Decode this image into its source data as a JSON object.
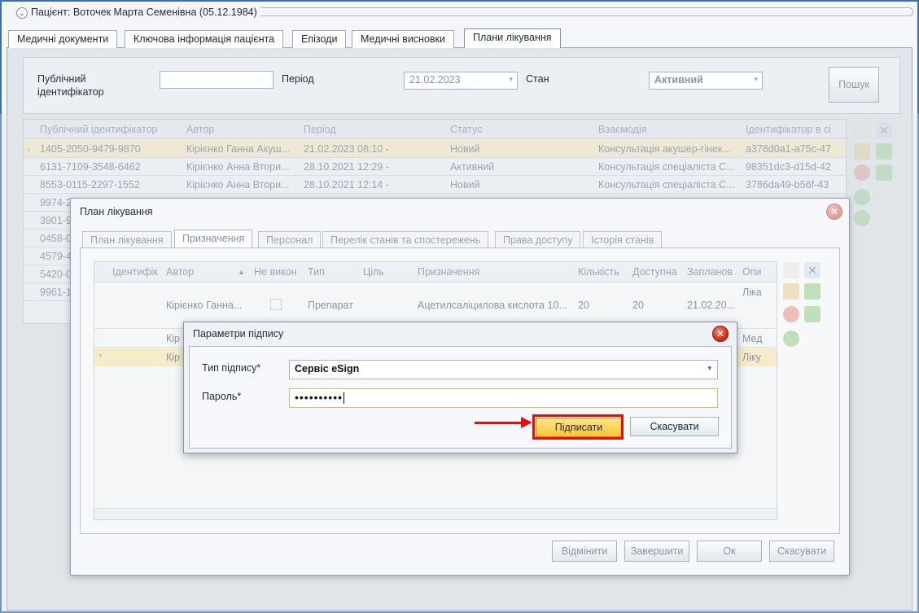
{
  "patient": {
    "title": "Пацієнт: Воточек Марта Семенівна (05.12.1984)"
  },
  "tabs": [
    {
      "label": "Медичні документи"
    },
    {
      "label": "Ключова інформація пацієнта"
    },
    {
      "label": "Епізоди"
    },
    {
      "label": "Медичні висновки"
    },
    {
      "label": "Плани лікування"
    }
  ],
  "filter": {
    "public_id_label": "Публічний ідентифікатор",
    "public_id_value": "",
    "period_label": "Період",
    "period_value": "21.02.2023",
    "state_label": "Стан",
    "state_value": "Активний",
    "search_label": "Пошук"
  },
  "grid": {
    "columns": [
      "Публічний ідентифікатор",
      "Автор",
      "Період",
      "Статус",
      "Взаємодія",
      "Ідентифікатор в сі"
    ],
    "rows": [
      [
        "1405-2050-9479-9870",
        "Кірієнко Ганна Акуш...",
        "21.02.2023 08:10 -",
        "Новий",
        "Консультація акушер-гінек...",
        "a378d0a1-a75c-47"
      ],
      [
        "6131-7109-3548-6462",
        "Кірієнко Анна Втори...",
        "28.10.2021 12:29 -",
        "Активний",
        "Консультація спеціаліста С...",
        "98351dc3-d15d-42"
      ],
      [
        "8553-0115-2297-1552",
        "Кірієнко Анна Втори...",
        "28.10.2021 12:14 -",
        "Новий",
        "Консультація спеціаліста С...",
        "3786da49-b56f-43"
      ],
      [
        "9974-2"
      ],
      [
        "3901-9"
      ],
      [
        "0458-0"
      ],
      [
        "4579-4"
      ],
      [
        "5420-0"
      ],
      [
        "9961-1"
      ]
    ]
  },
  "plan_dialog": {
    "title": "План лікування",
    "tabs": [
      {
        "label": "План лікування"
      },
      {
        "label": "Призначення"
      },
      {
        "label": "Персонал"
      },
      {
        "label": "Перелік станів та спостережень"
      },
      {
        "label": "Права доступу"
      },
      {
        "label": "Історія станів"
      }
    ],
    "grid": {
      "columns": [
        "Ідентифік",
        "Автор",
        "Не викон",
        "Тип",
        "Ціль",
        "Призначення",
        "Кількість",
        "Доступна",
        "Запланов",
        "Опи"
      ],
      "row1": [
        "Кірієнко Ганна...",
        "Препарат",
        "Ацетилсаліцилова кислота 10...",
        "20",
        "20",
        "21.02.20...",
        "Ліка"
      ],
      "row2_author": "Кір",
      "row2_desc": "Мед",
      "row3_author": "Кір",
      "row3_desc": "Ліку"
    },
    "buttons": {
      "undo": "Відмінити",
      "finish": "Завершити",
      "ok": "Ок",
      "cancel": "Скасувати"
    }
  },
  "sign_dialog": {
    "title": "Параметри підпису",
    "sign_type_label": "Тип підпису*",
    "sign_type_value": "Сервіс eSign",
    "password_label": "Пароль*",
    "password_value": "••••••••••",
    "sign_button": "Підписати",
    "cancel_button": "Скасувати"
  },
  "colors": {
    "accent_frame": "#3a6ea5",
    "selected_row": "#f7ecc9",
    "primary_button": "#f7c635",
    "highlight_box": "#e01010"
  }
}
